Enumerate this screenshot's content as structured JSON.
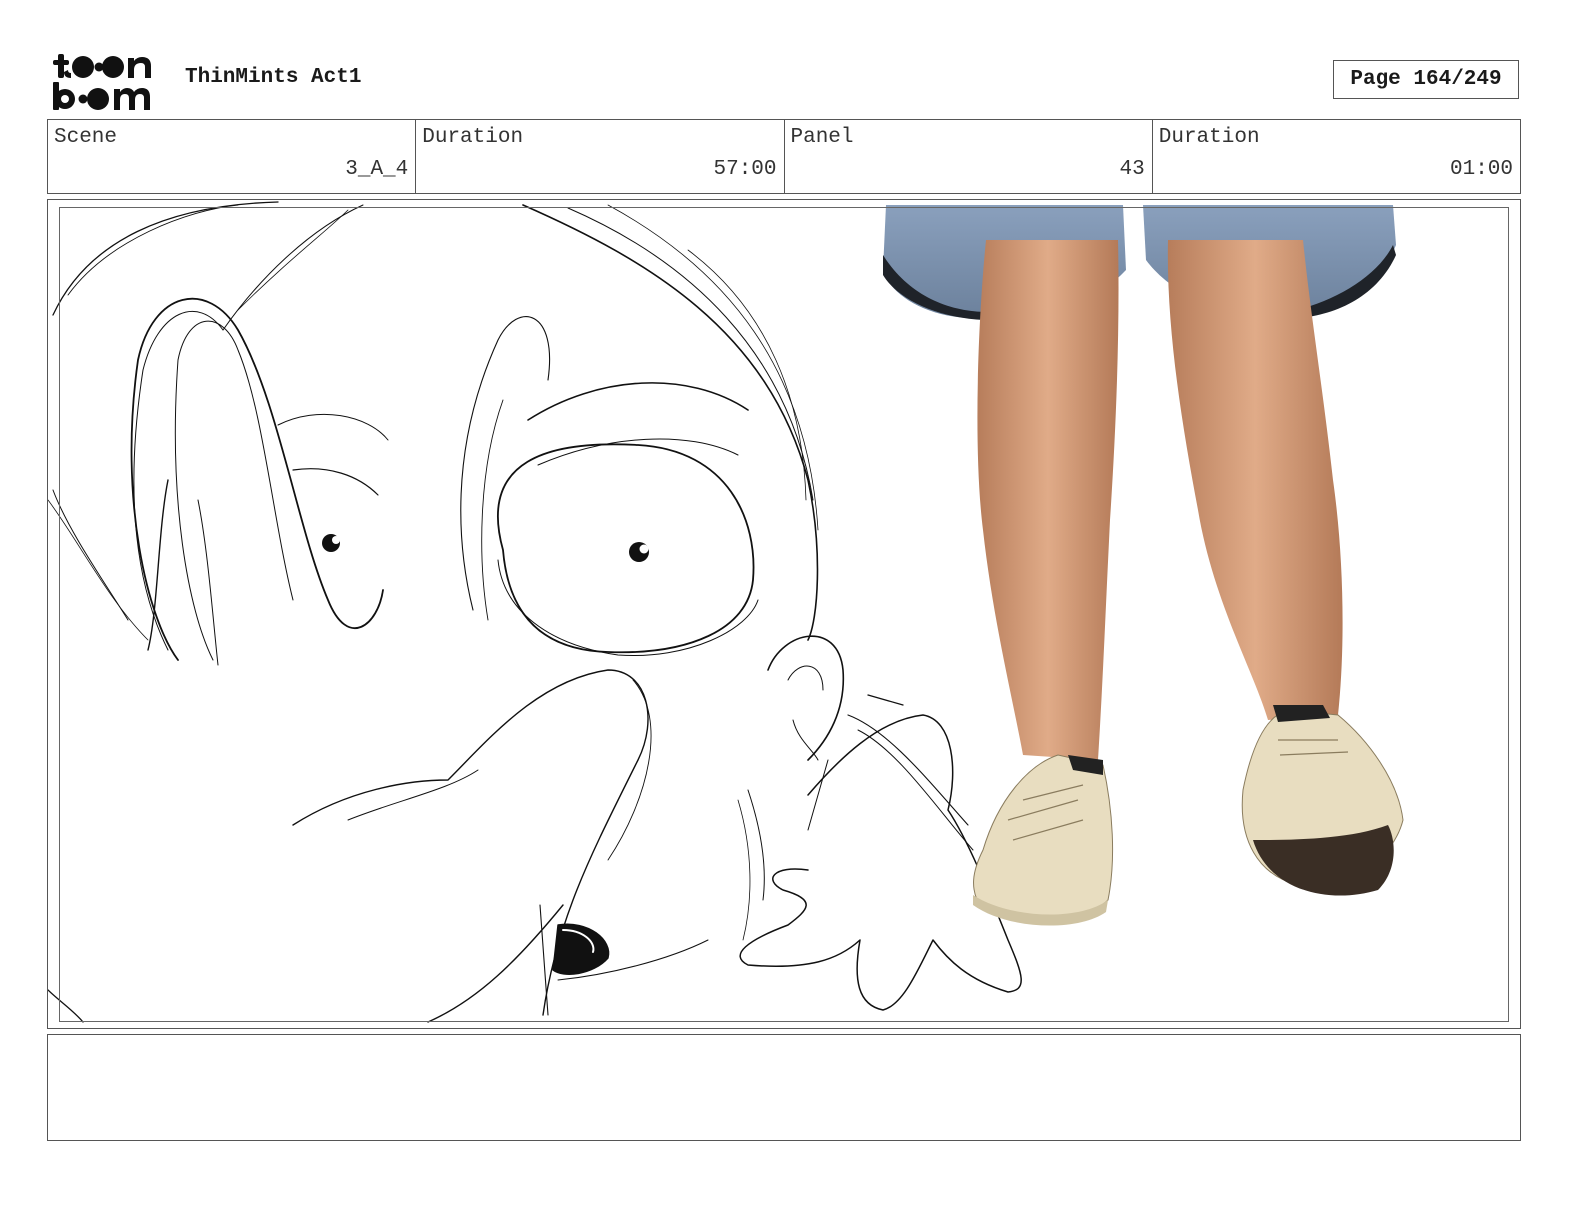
{
  "header": {
    "logo_text": "toon boom",
    "project_title": "ThinMints Act1",
    "page_label": "Page 164/249"
  },
  "info": {
    "scene_label": "Scene",
    "scene_value": "3_A_4",
    "scene_duration_label": "Duration",
    "scene_duration_value": "57:00",
    "panel_label": "Panel",
    "panel_value": "43",
    "panel_duration_label": "Duration",
    "panel_duration_value": "01:00"
  },
  "panel": {
    "description": ""
  },
  "notes": {
    "text": ""
  },
  "colors": {
    "frame": "#555555",
    "sketch_line": "#111111",
    "skin": "#d9a27f",
    "shorts": "#7f93ad",
    "shoe": "#e9dfc3"
  }
}
